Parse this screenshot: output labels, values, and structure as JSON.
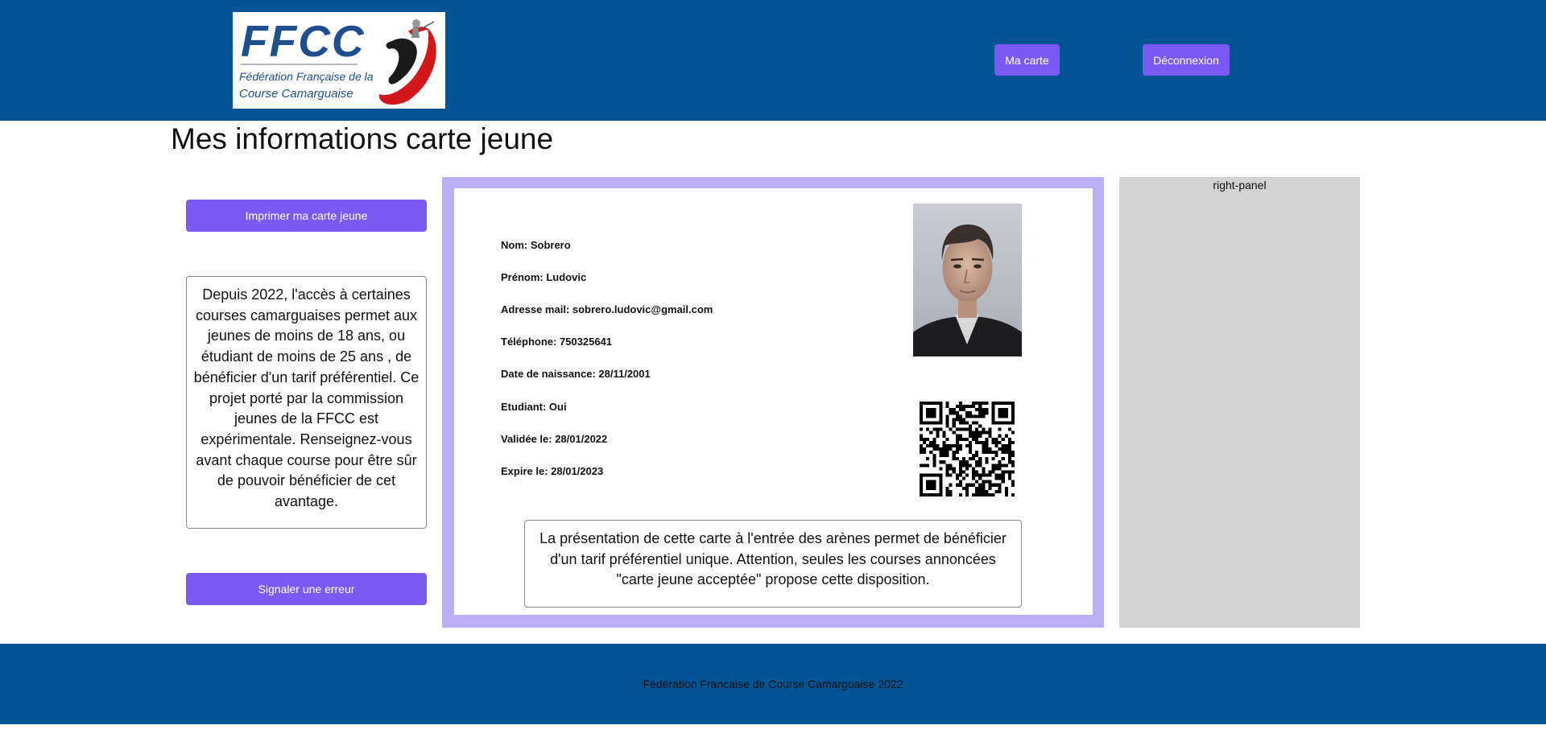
{
  "header": {
    "logo": {
      "acronym": "FFCC",
      "line1": "Fédération Française de la",
      "line2": "Course Camarguaise"
    },
    "nav": {
      "card_label": "Ma carte",
      "logout_label": "Déconnexion"
    }
  },
  "page": {
    "title": "Mes informations carte jeune"
  },
  "sidebar": {
    "print_label": "Imprimer ma carte jeune",
    "info_text": "Depuis 2022, l'accès à certaines courses camarguaises permet aux jeunes de moins de 18 ans, ou étudiant de moins de 25 ans , de bénéficier d'un tarif préférentiel. Ce projet porté par la commission jeunes de la FFCC est expérimentale. Renseignez-vous avant chaque course pour être sûr de pouvoir bénéficier de cet avantage.",
    "report_label": "Signaler une erreur"
  },
  "card": {
    "fields": [
      "Nom: Sobrero",
      "Prénom: Ludovic",
      "Adresse mail: sobrero.ludovic@gmail.com",
      "Téléphone: 750325641",
      "Date de naissance: 28/11/2001",
      "Etudiant: Oui",
      "Validée le: 28/01/2022",
      "Expire le: 28/01/2023"
    ],
    "notice": "La présentation de cette carte à l'entrée des arènes permet de bénéficier d'un tarif préférentiel unique. Attention, seules les courses annoncées \"carte jeune acceptée\" propose cette disposition."
  },
  "right_panel": {
    "label": "right-panel"
  },
  "footer": {
    "text": "Fédération Francaise de Course Camarguaise 2022"
  },
  "colors": {
    "header_bg": "#025494",
    "button": "#7b59f4",
    "card_border": "#bcaef7",
    "panel": "#d3d3d3"
  }
}
